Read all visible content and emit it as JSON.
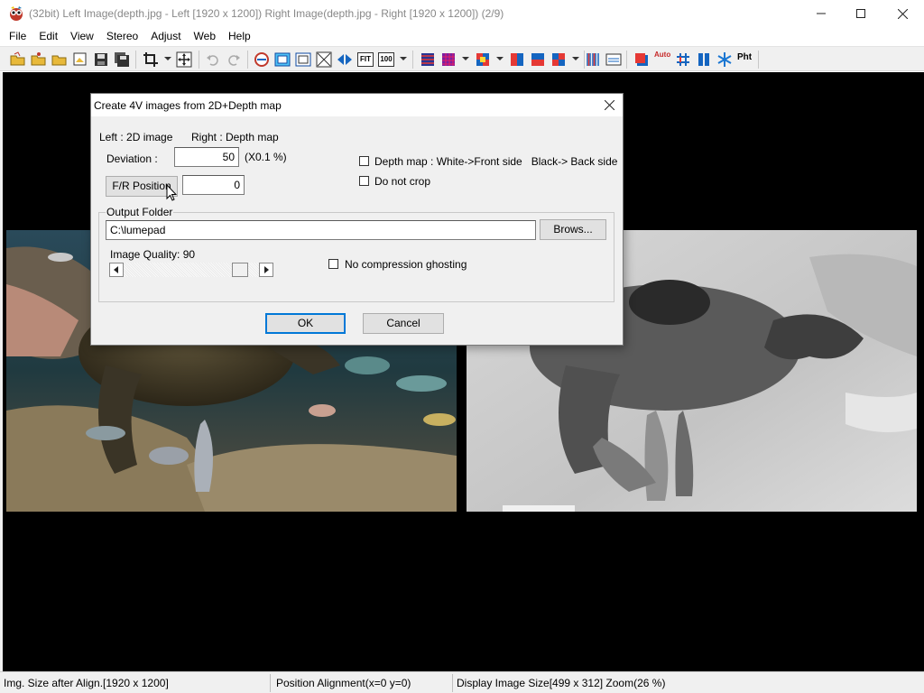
{
  "window": {
    "title": "(32bit) Left Image(depth.jpg - Left [1920 x 1200]) Right Image(depth.jpg - Right [1920 x 1200]) (2/9)",
    "minimize_icon": "minimize-icon",
    "maximize_icon": "maximize-icon",
    "close_icon": "close-icon"
  },
  "menu": [
    "File",
    "Edit",
    "View",
    "Stereo",
    "Adjust",
    "Web",
    "Help"
  ],
  "toolbar": {
    "icons": [
      "open-folder-icon",
      "open-multi-icon",
      "open-folder-alt-icon",
      "open-image-icon",
      "save-icon",
      "save-copy-icon",
      "crop-icon",
      "crop-dropdown",
      "auto-align-icon",
      "undo-icon",
      "redo-icon",
      "swap-lr-icon",
      "window-frame-icon",
      "fit-frame-icon",
      "fullscreen-icon",
      "fit-icon",
      "fit-width-icon",
      "zoom-100-icon",
      "zoom-dropdown",
      "anaglyph-icon",
      "interlaced-icon",
      "interlaced-dropdown",
      "checker-icon",
      "checker-dropdown",
      "red-blue-icon",
      "blue-red-icon",
      "quad-icon",
      "quad-dropdown",
      "column-interleave-icon",
      "glasses-icon",
      "red-square-icon",
      "auto-adjust-icon",
      "grid-icon",
      "side-by-side-icon",
      "snowflake-icon",
      "print-icon"
    ],
    "fit_label": "FIT",
    "zoom_label": "100",
    "auto_label": "Auto",
    "print_label": "Pht"
  },
  "dialog": {
    "title": "Create 4V images from 2D+Depth map",
    "left_label": "Left : 2D image",
    "right_label": "Right : Depth map",
    "deviation_label": "Deviation :",
    "deviation_value": "50",
    "deviation_unit": "(X0.1 %)",
    "fr_position_button": "F/R Position",
    "fr_position_value": "0",
    "depth_map_checkbox": "Depth map : White->Front side   Black-> Back side",
    "depth_map_checked": false,
    "no_crop_checkbox": "Do not crop",
    "no_crop_checked": false,
    "output_folder_label": "Output Folder",
    "output_folder_value": "C:\\lumepad",
    "browse_button": "Brows...",
    "image_quality_label": "Image Quality: 90",
    "image_quality_value": 90,
    "no_compression_checkbox": "No compression ghosting",
    "no_compression_checked": false,
    "ok_button": "OK",
    "cancel_button": "Cancel"
  },
  "status": {
    "size_after_align": "Img. Size after Align.[1920 x 1200]",
    "position_alignment": "Position Alignment(x=0 y=0)",
    "display_size": "Display Image Size[499 x 312]  Zoom(26 %)"
  },
  "colors": {
    "canvas": "#000000",
    "dialog_bg": "#f0f0f0",
    "default_button_border": "#0078d7"
  }
}
